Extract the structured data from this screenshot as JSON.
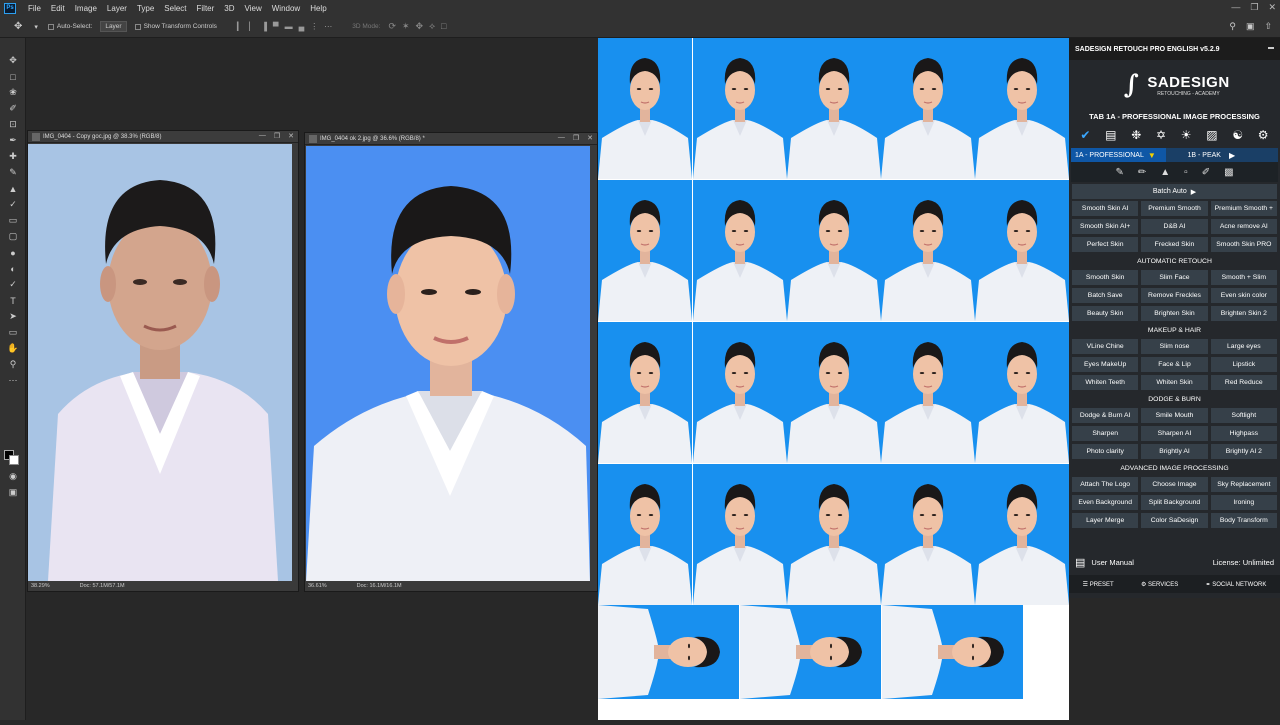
{
  "menubar": {
    "logo": "Ps",
    "items": [
      "File",
      "Edit",
      "Image",
      "Layer",
      "Type",
      "Select",
      "Filter",
      "3D",
      "View",
      "Window",
      "Help"
    ]
  },
  "options": {
    "auto_select_label": "Auto-Select:",
    "auto_select_value": "Layer",
    "show_transform_label": "Show Transform Controls",
    "mode_3d_label": "3D Mode:"
  },
  "documents": [
    {
      "title": "IMG_0404 - Copy goc.jpg @ 38.3% (RGB/8)",
      "zoom": "38.29%",
      "doc": "Doc: 57.1M/57.1M"
    },
    {
      "title": "IMG_0404 ok 2.jpg @ 36.6% (RGB/8) *",
      "zoom": "36.61%",
      "doc": "Doc: 16.1M/16.1M"
    }
  ],
  "panel": {
    "header": "SADESIGN RETOUCH PRO ENGLISH v5.2.9",
    "brand_name": "SADESIGN",
    "brand_tag": "RETOUCHING - ACADEMY",
    "tab_title": "TAB 1A - PROFESSIONAL IMAGE PROCESSING",
    "subtab_a": "1A - PROFESSIONAL",
    "subtab_b": "1B - PEAK",
    "batch_auto": "Batch Auto",
    "group1": [
      "Smooth Skin AI",
      "Premium Smooth",
      "Premium Smooth +",
      "Smooth Skin AI+",
      "D&B AI",
      "Acne remove AI",
      "Perfect Skin",
      "Frecked Skin",
      "Smooth Skin PRO"
    ],
    "section_auto": "AUTOMATIC RETOUCH",
    "group2": [
      "Smooth Skin",
      "Slim Face",
      "Smooth + Slim",
      "Batch Save",
      "Remove Freckles",
      "Even skin color",
      "Beauty Skin",
      "Brighten Skin",
      "Brighten Skin 2"
    ],
    "section_makeup": "MAKEUP & HAIR",
    "group3": [
      "VLine Chine",
      "Slim nose",
      "Large eyes",
      "Eyes MakeUp",
      "Face & Lip",
      "Lipstick",
      "Whiten Teeth",
      "Whiten Skin",
      "Red Reduce"
    ],
    "section_dodge": "DODGE & BURN",
    "group4": [
      "Dodge & Burn AI",
      "Smile Mouth",
      "Softlight",
      "Sharpen",
      "Sharpen AI",
      "Highpass",
      "Photo clarity",
      "Brightly AI",
      "Brightly AI 2"
    ],
    "section_adv": "ADVANCED IMAGE PROCESSING",
    "group5": [
      "Attach The Logo",
      "Choose Image",
      "Sky Replacement",
      "Even Background",
      "Split Background",
      "Ironing",
      "Layer Merge",
      "Color SaDesign",
      "Body Transform"
    ],
    "user_manual": "User Manual",
    "license": "License: Unlimited",
    "preset": "PRESET",
    "services": "SERVICES",
    "social": "SOCIAL NETWORK"
  }
}
